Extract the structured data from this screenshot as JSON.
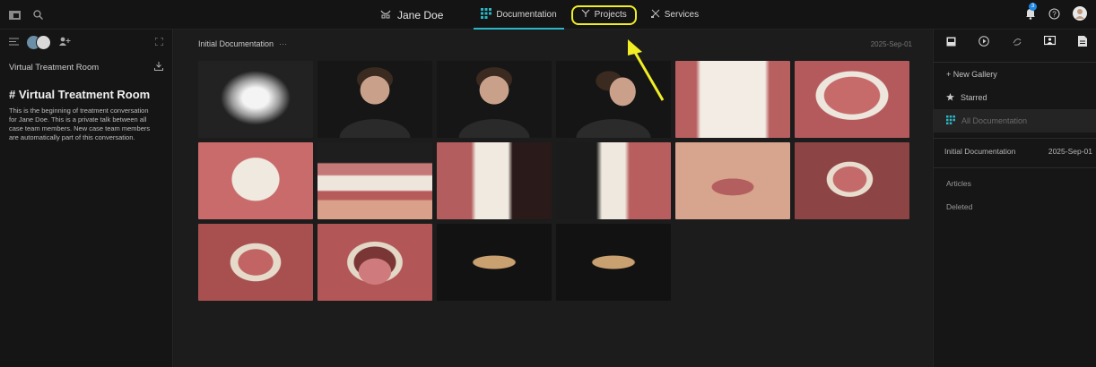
{
  "topbar": {
    "patient_name": "Jane Doe",
    "tabs": [
      {
        "label": "Documentation",
        "icon": "grid-icon"
      },
      {
        "label": "Projects",
        "icon": "branch-icon"
      },
      {
        "label": "Services",
        "icon": "tools-icon"
      }
    ],
    "notification_count": "3"
  },
  "left": {
    "room_label": "Virtual Treatment Room",
    "room_title": "# Virtual Treatment Room",
    "room_description": "This is the beginning of treatment conversation for Jane Doe. This is a private talk between all case team members. New case team members are automatically part of this conversation."
  },
  "main": {
    "gallery_title": "Initial Documentation",
    "more_label": "···",
    "date": "2025-Sep-01",
    "photos": [
      {
        "kind": "xray"
      },
      {
        "kind": "portrait-front"
      },
      {
        "kind": "portrait-front"
      },
      {
        "kind": "portrait-profile"
      },
      {
        "kind": "intraoral-upper"
      },
      {
        "kind": "intraoral-palate"
      },
      {
        "kind": "intraoral-retracted"
      },
      {
        "kind": "smile-wide"
      },
      {
        "kind": "intraoral-side"
      },
      {
        "kind": "intraoral-side-dark"
      },
      {
        "kind": "chin-up"
      },
      {
        "kind": "intraoral-lower"
      },
      {
        "kind": "intraoral-occlusal"
      },
      {
        "kind": "intraoral-tongue"
      },
      {
        "kind": "scan-model"
      },
      {
        "kind": "scan-model"
      }
    ]
  },
  "right": {
    "new_gallery": "+ New Gallery",
    "starred": "Starred",
    "all_documentation": "All Documentation",
    "doc_title": "Initial Documentation",
    "doc_date": "2025-Sep-01",
    "articles": "Articles",
    "deleted": "Deleted"
  },
  "colors": {
    "accent": "#2bb7c6",
    "highlight": "#f1ee25",
    "notification": "#1e88e5"
  }
}
